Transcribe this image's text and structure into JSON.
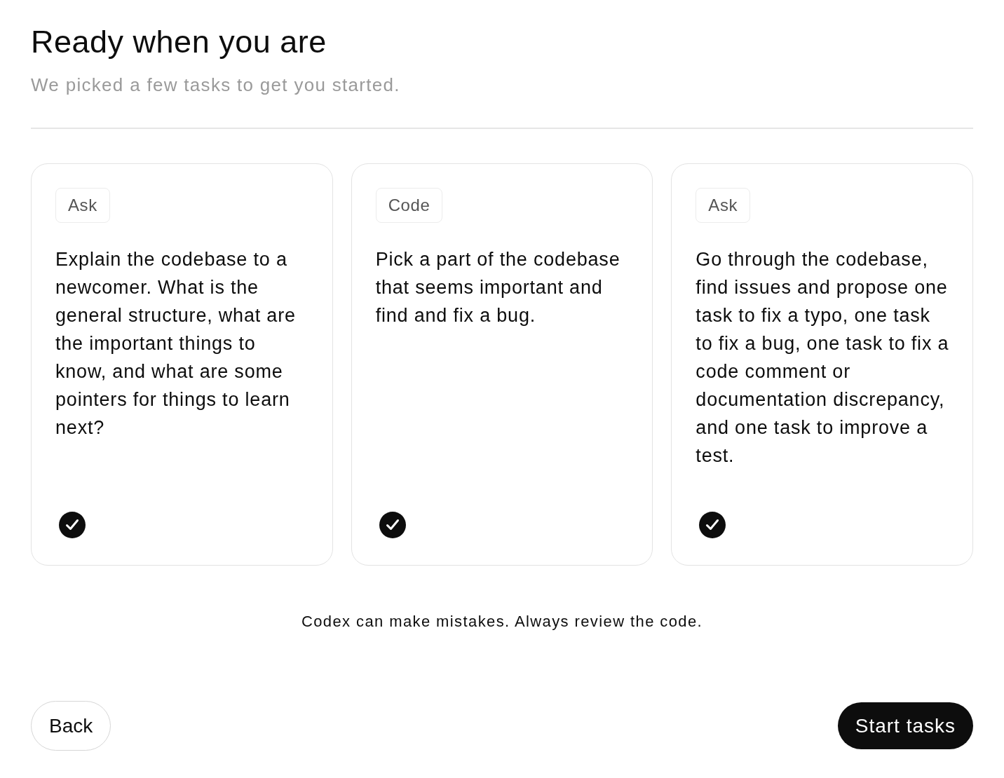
{
  "header": {
    "title": "Ready when you are",
    "subtitle": "We picked a few tasks to get you started."
  },
  "tasks": [
    {
      "tag": "Ask",
      "text": "Explain the codebase to a newcomer. What is the general structure, what are the important things to know, and what are some pointers for things to learn next?",
      "selected": true
    },
    {
      "tag": "Code",
      "text": "Pick a part of the codebase that seems important and find and fix a bug.",
      "selected": true
    },
    {
      "tag": "Ask",
      "text": "Go through the codebase, find issues and propose one task to fix a typo, one task to fix a bug, one task to fix a code comment or documentation discrepancy, and one task to improve a test.",
      "selected": true
    }
  ],
  "disclaimer": "Codex can make mistakes. Always review the code.",
  "buttons": [
    {
      "kind": "secondary",
      "label": "Back"
    },
    {
      "kind": "primary",
      "label": "Start tasks"
    }
  ]
}
